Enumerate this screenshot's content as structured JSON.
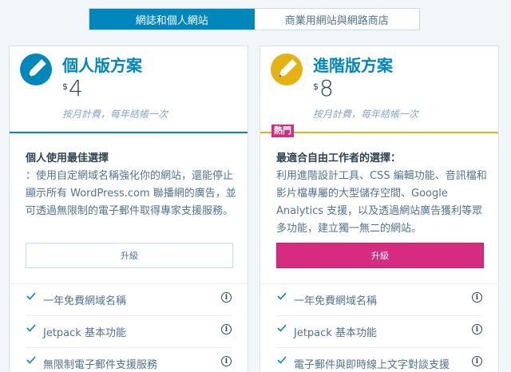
{
  "tabs": [
    {
      "label": "網誌和個人網站",
      "active": true
    },
    {
      "label": "商業用網站與網路商店",
      "active": false
    }
  ],
  "plans": [
    {
      "name": "個人版方案",
      "currency": "$",
      "price": "4",
      "billing": "按月計費，每年結帳一次",
      "icon": "pencil-icon",
      "icon_color": "#0087be",
      "badge": "",
      "lead": "個人使用最佳選擇",
      "description": "：使用自定網域名稱強化你的網站，還能停止顯示所有 WordPress.com 聯播網的廣告，並可透過無限制的電子郵件取得專家支援服務。",
      "button": "升級",
      "features": [
        "一年免費網域名稱",
        "Jetpack 基本功能",
        "無限制電子郵件支援服務"
      ]
    },
    {
      "name": "進階版方案",
      "currency": "$",
      "price": "8",
      "billing": "按月計費，每年結帳一次",
      "icon": "pencil-icon",
      "icon_color": "#e4b312",
      "badge": "熱門",
      "lead": "最適合自由工作者的選擇：",
      "description": "利用進階設計工具、CSS 編輯功能、音訊檔和影片檔專屬的大型儲存空間、Google Analytics 支援，以及透過網站廣告獲利等眾多功能，建立獨一無二的網站。",
      "button": "升級",
      "features": [
        "一年免費網域名稱",
        "Jetpack 基本功能",
        "電子郵件與即時線上文字對談支援"
      ]
    }
  ]
}
